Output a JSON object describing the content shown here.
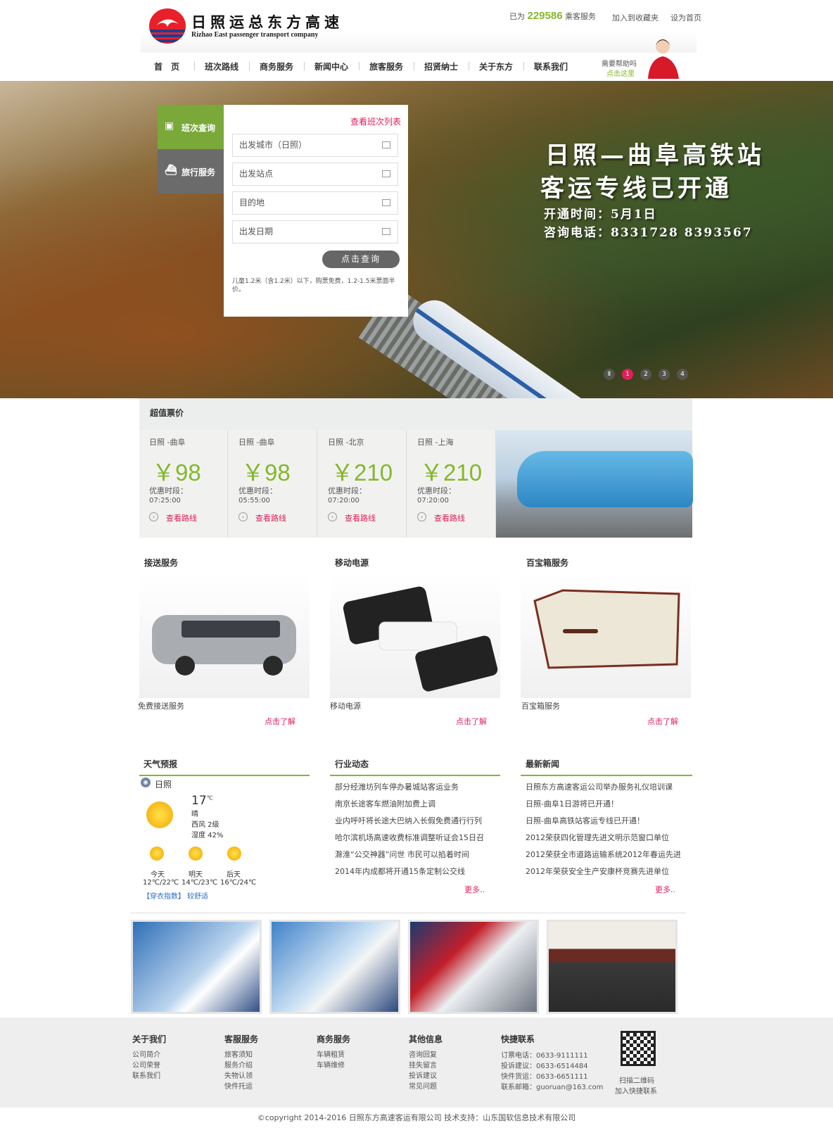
{
  "header": {
    "logo_cn": "日照运总东方高速",
    "logo_en": "Rizhao East passenger transport company",
    "stats_prefix": "已为",
    "stats_count": "229586",
    "stats_suffix": "乘客服务",
    "favorite": "加入到收藏夹",
    "homepage": "设为首页"
  },
  "nav": {
    "items": [
      "首　页",
      "班次路线",
      "商务服务",
      "新闻中心",
      "旅客服务",
      "招贤纳士",
      "关于东方",
      "联系我们"
    ],
    "help": "需要帮助吗",
    "help_sub": "点击这里"
  },
  "banner": {
    "title1": "日照—曲阜高铁站",
    "title2": "客运专线已开通",
    "line1": "开通时间：5月1日",
    "line2": "咨询电话：8331728 8393567",
    "dots": [
      "Ⅱ",
      "1",
      "2",
      "3",
      "4"
    ],
    "active_dot": 1
  },
  "search": {
    "tab1": "班次查询",
    "tab2": "旅行服务",
    "list_link": "查看班次列表",
    "fields": [
      "出发城市（日照）",
      "出发站点",
      "目的地",
      "出发日期"
    ],
    "button": "点击查询",
    "note": "儿童1.2米（含1.2米）以下，购票免费，1.2-1.5米票面半价。"
  },
  "deals": {
    "title": "超值票价",
    "items": [
      {
        "route": "日照 -曲阜",
        "price": "￥98",
        "time_label": "优惠时段：",
        "time": "07:25:00",
        "link": "查看路线"
      },
      {
        "route": "日照 -曲阜",
        "price": "￥98",
        "time_label": "优惠时段：",
        "time": "05:55:00",
        "link": "查看路线"
      },
      {
        "route": "日照 -北京",
        "price": "￥210",
        "time_label": "优惠时段：",
        "time": "07:20:00",
        "link": "查看路线"
      },
      {
        "route": "日照 -上海",
        "price": "￥210",
        "time_label": "优惠时段：",
        "time": "07:20:00",
        "link": "查看路线"
      }
    ]
  },
  "services": [
    {
      "title": "接送服务",
      "caption": "免费接送服务",
      "more": "点击了解"
    },
    {
      "title": "移动电源",
      "caption": "移动电源",
      "more": "点击了解"
    },
    {
      "title": "百宝箱服务",
      "caption": "百宝箱服务",
      "more": "点击了解"
    }
  ],
  "weather": {
    "title": "天气预报",
    "city": "日照",
    "temp": "17",
    "unit": "℃",
    "cond": "晴",
    "wind": "西风 2级",
    "humidity": "湿度 42%",
    "days": [
      {
        "name": "今天",
        "range": "12℃/22℃"
      },
      {
        "name": "明天",
        "range": "14℃/23℃"
      },
      {
        "name": "后天",
        "range": "16℃/24℃"
      }
    ],
    "index_label": "【穿衣指数】",
    "index_val": "较舒适"
  },
  "industry": {
    "title": "行业动态",
    "items": [
      "部分经潍坊列车停办暑城站客运业务",
      "南京长途客车燃油附加费上调",
      "业内呼吁将长途大巴纳入长假免费通行行列",
      "哈尔滨机场高速收费标准调整听证会15日召",
      "滁淮“公交神器”问世 市民可以掐着时间",
      "2014年内成都将开通15条定制公交线"
    ],
    "more": "更多.."
  },
  "latest": {
    "title": "最新新闻",
    "items": [
      "日照东方高速客运公司举办服务礼仪培训课",
      "日照-曲阜1日游将已开通！",
      "日照-曲阜高铁站客运专线已开通！",
      "2012荣获四化管理先进文明示范窗口单位",
      "2012荣获全市道路运输系统2012年春运先进",
      "2012年荣获安全生产安康杯竞赛先进单位"
    ],
    "more": "更多.."
  },
  "footer": {
    "cols": [
      {
        "title": "关于我们",
        "links": [
          "公司简介",
          "公司荣誉",
          "联系我们"
        ]
      },
      {
        "title": "客服服务",
        "links": [
          "旅客须知",
          "服务介绍",
          "失物认领",
          "快件托运"
        ]
      },
      {
        "title": "商务服务",
        "links": [
          "车辆租赁",
          "车辆维修"
        ]
      },
      {
        "title": "其他信息",
        "links": [
          "咨询回复",
          "挂失留言",
          "投诉建议",
          "常见问题"
        ]
      },
      {
        "title": "快捷联系",
        "links": [
          "订票电话：0633-9111111",
          "投诉建议：0633-6514484",
          "快件货运：0633-6651111",
          "联系邮箱：guoruan@163.com"
        ]
      }
    ],
    "qr1": "扫描二维码",
    "qr2": "加入快捷联系",
    "copyright": "©copyright  2014-2016  日照东方高速客运有限公司    技术支持：山东国软信息技术有限公司"
  },
  "colors": {
    "accent": "#84b82b",
    "link": "#e0205a",
    "tab_active": "#7aa93a",
    "tab_inactive": "#6b6b6b"
  }
}
